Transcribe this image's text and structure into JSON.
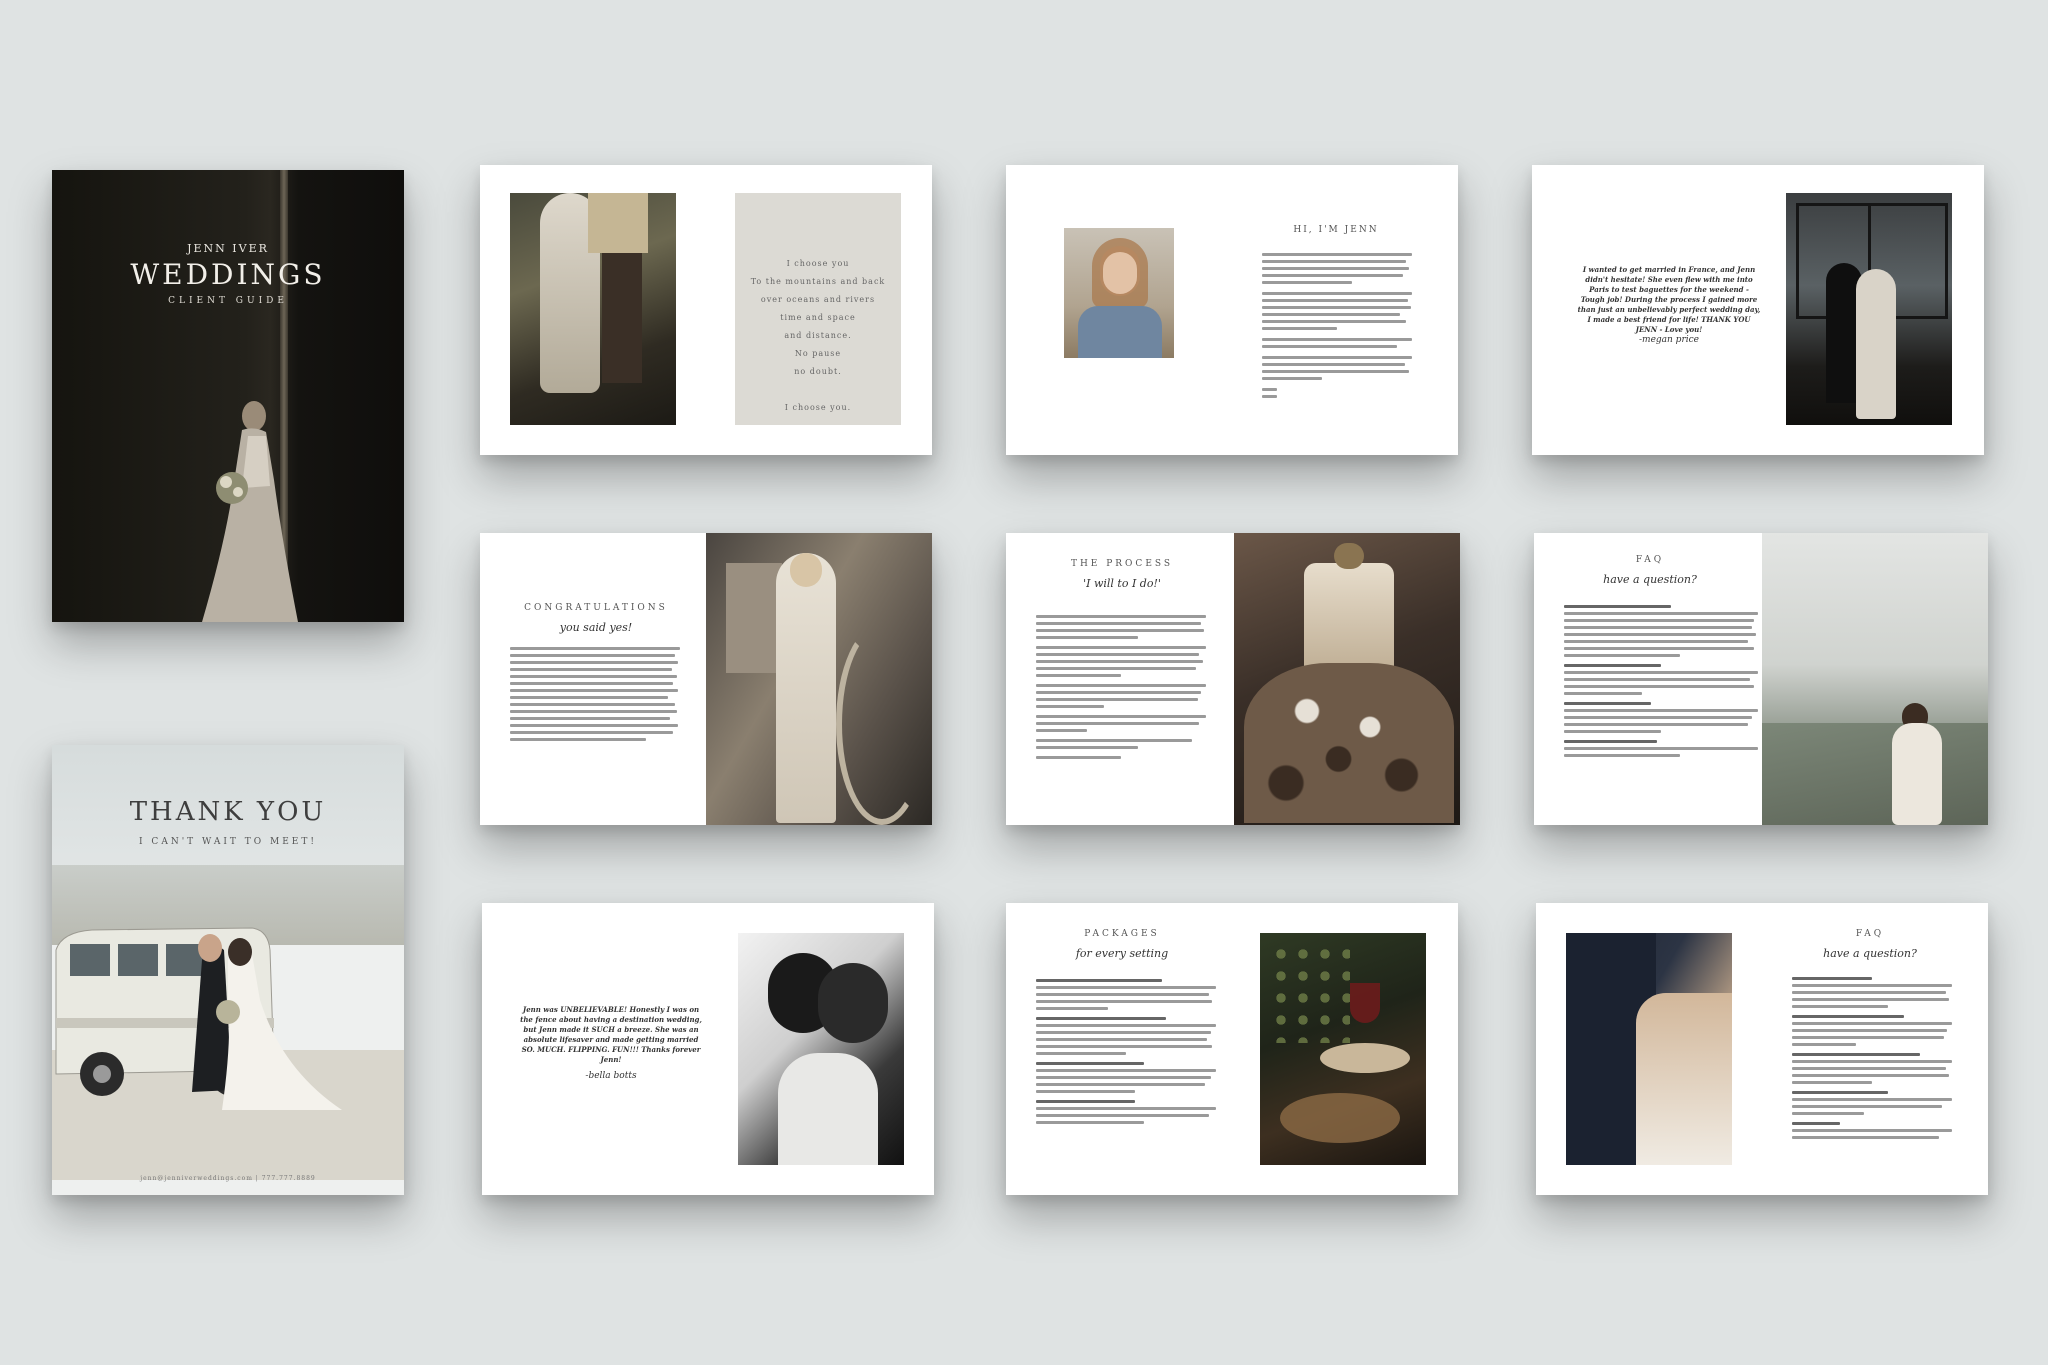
{
  "cover": {
    "name": "JENN IVER",
    "title": "WEDDINGS",
    "subtitle": "CLIENT GUIDE"
  },
  "thank_you": {
    "title": "THANK YOU",
    "subtitle": "I CAN'T WAIT TO MEET!",
    "footer": "jenn@jenniverweddings.com | 777.777.8889"
  },
  "poem": {
    "lines": [
      "I choose you",
      "To the mountains and back",
      "over oceans and rivers",
      "time and space",
      "and distance.",
      "No pause",
      "no doubt.",
      "",
      "I choose you."
    ]
  },
  "about": {
    "title": "HI, I'M JENN"
  },
  "testimonial1": {
    "quote": "I wanted to get married in France, and Jenn didn't hesitate! She even flew with me into Paris to test baguettes for the weekend - Tough job! During the process I gained more than just an unbelievably perfect wedding day, I made a best friend for life! THANK YOU JENN - Love you!",
    "signature": "-megan price"
  },
  "congrats": {
    "title": "CONGRATULATIONS",
    "script": "you said yes!"
  },
  "process": {
    "title": "THE PROCESS",
    "script": "'I will to I do!'"
  },
  "faq1": {
    "title": "FAQ",
    "script": "have a question?"
  },
  "testimonial2": {
    "quote": "Jenn was UNBELIEVABLE! Honestly I was on the fence about having a destination wedding, but Jenn made it SUCH a breeze. She was an absolute lifesaver and made getting married SO. MUCH. FLIPPING. FUN!!! Thanks forever Jenn!",
    "signature": "-bella botts"
  },
  "packages": {
    "title": "PACKAGES",
    "script": "for every setting"
  },
  "faq2": {
    "title": "FAQ",
    "script": "have a question?"
  }
}
